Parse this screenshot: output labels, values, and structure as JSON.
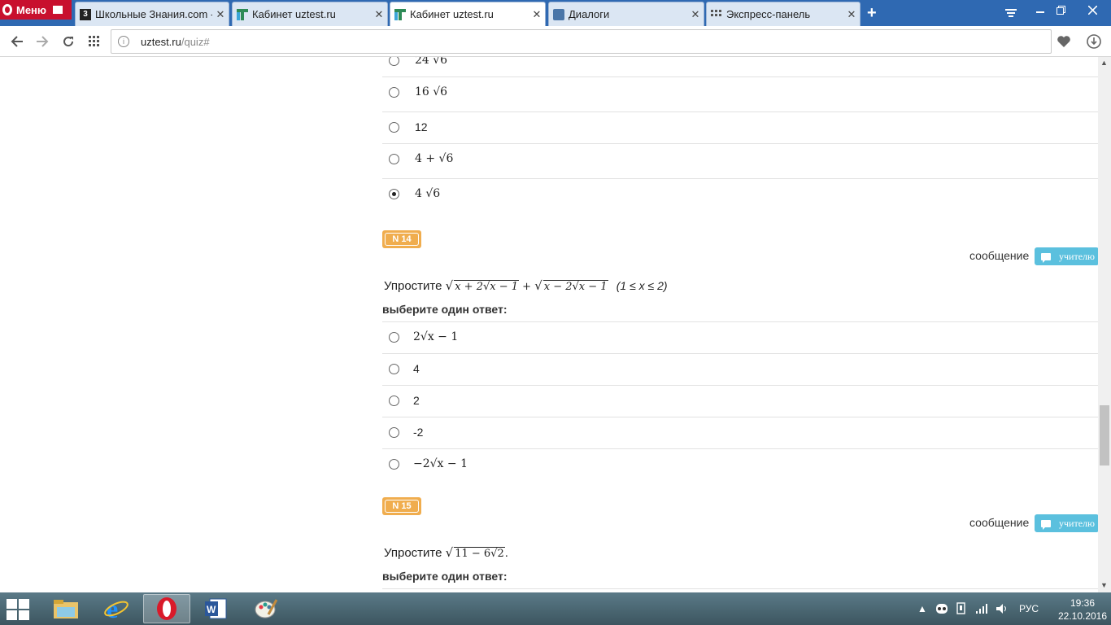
{
  "browser": {
    "menu_label": "Меню",
    "tabs": [
      {
        "title": "Школьные Знания.com - З",
        "favicon": "3",
        "fav_color": "#222222",
        "active": false
      },
      {
        "title": "Кабинет uztest.ru",
        "favicon": "",
        "fav_color": "#2e8b57",
        "active": false
      },
      {
        "title": "Кабинет uztest.ru",
        "favicon": "",
        "fav_color": "#2e8b57",
        "active": true
      },
      {
        "title": "Диалоги",
        "favicon": "",
        "fav_color": "#4a76a8",
        "active": false
      },
      {
        "title": "Экспресс-панель",
        "favicon": "",
        "fav_color": "#555555",
        "active": false
      }
    ],
    "new_tab_icon": "plus-icon",
    "url_host": "uztest.ru",
    "url_path": "/quiz#"
  },
  "quiz": {
    "prev_options": [
      {
        "text": "24 √6",
        "checked": false
      },
      {
        "text": "16 √6",
        "checked": false
      },
      {
        "text": "12",
        "checked": false
      },
      {
        "text": "4 + √6",
        "checked": false
      },
      {
        "text": "4 √6",
        "checked": true
      }
    ],
    "q14": {
      "badge": "N 14",
      "message_label": "сообщение",
      "teacher_button": "учителю",
      "prompt": "Упростите",
      "expression_a": "x + 2√x − 1",
      "expression_b": "x − 2√x − 1",
      "plus": "+",
      "condition": "(1 ≤ x ≤ 2)",
      "choose_label": "выберите один ответ:",
      "options": [
        {
          "text": "2√x − 1",
          "checked": false
        },
        {
          "text": "4",
          "checked": false
        },
        {
          "text": "2",
          "checked": false
        },
        {
          "text": "-2",
          "checked": false
        },
        {
          "text": "−2√x − 1",
          "checked": false
        }
      ]
    },
    "q15": {
      "badge": "N 15",
      "message_label": "сообщение",
      "teacher_button": "учителю",
      "prompt": "Упростите",
      "expression": "11 − 6√2",
      "period": ".",
      "choose_label": "выберите один ответ:"
    }
  },
  "taskbar": {
    "language": "РУС",
    "time": "19:36",
    "date": "22.10.2016"
  }
}
